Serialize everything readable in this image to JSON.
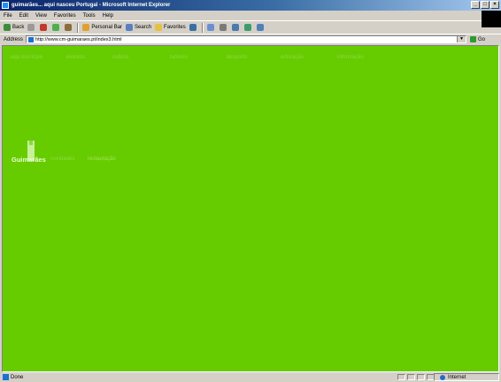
{
  "window": {
    "title": "guimarães... aqui nasceu Portugal - Microsoft Internet Explorer",
    "controls": [
      "_",
      "□",
      "×"
    ]
  },
  "menu": [
    "File",
    "Edit",
    "View",
    "Favorites",
    "Tools",
    "Help"
  ],
  "toolbar": {
    "back": "Back",
    "personal_bar": "Personal Bar",
    "search": "Search",
    "favorites": "Favorites"
  },
  "address": {
    "label": "Address",
    "url": "http://www.cm-guimaraes.pt/index3.html",
    "go": "Go"
  },
  "site": {
    "nav": [
      "seja munícipe",
      "eventos",
      "cultura",
      "turismo",
      "desporto",
      "educação",
      "informação"
    ],
    "logo_name": "Guimarães",
    "logo_sub1": "novidades",
    "logo_sub2": "restauração"
  },
  "status": {
    "text": "Done",
    "zone": "Internet"
  },
  "colors": {
    "page_background": "#66cc00",
    "nav_text": "#8cd840",
    "chrome": "#d4d0c8",
    "titlebar": "#0a246a"
  }
}
